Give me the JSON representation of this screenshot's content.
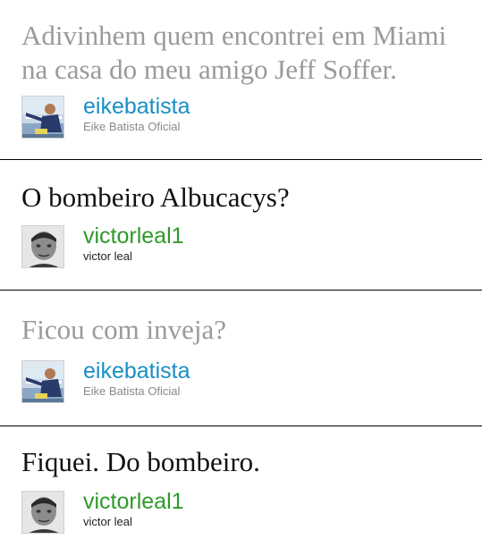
{
  "tweets": [
    {
      "text_lines": [
        "Adivinhem quem encontrei em Miami",
        "na casa do meu amigo Jeff Soffer."
      ],
      "handle": "eikebatista",
      "name": "Eike Batista Oficial",
      "style": "muted",
      "handle_color": "#1a8fc4",
      "avatar": "eike-avatar"
    },
    {
      "text_lines": [
        "O bombeiro Albucacys?"
      ],
      "handle": "victorleal1",
      "name": "victor leal",
      "style": "dark",
      "handle_color": "#2f9a2a",
      "avatar": "victor-avatar"
    },
    {
      "text_lines": [
        "Ficou com inveja?"
      ],
      "handle": "eikebatista",
      "name": "Eike Batista Oficial",
      "style": "muted",
      "handle_color": "#1a8fc4",
      "avatar": "eike-avatar"
    },
    {
      "text_lines": [
        "Fiquei. Do bombeiro."
      ],
      "handle": "victorleal1",
      "name": "victor leal",
      "style": "dark",
      "handle_color": "#2f9a2a",
      "avatar": "victor-avatar"
    }
  ]
}
